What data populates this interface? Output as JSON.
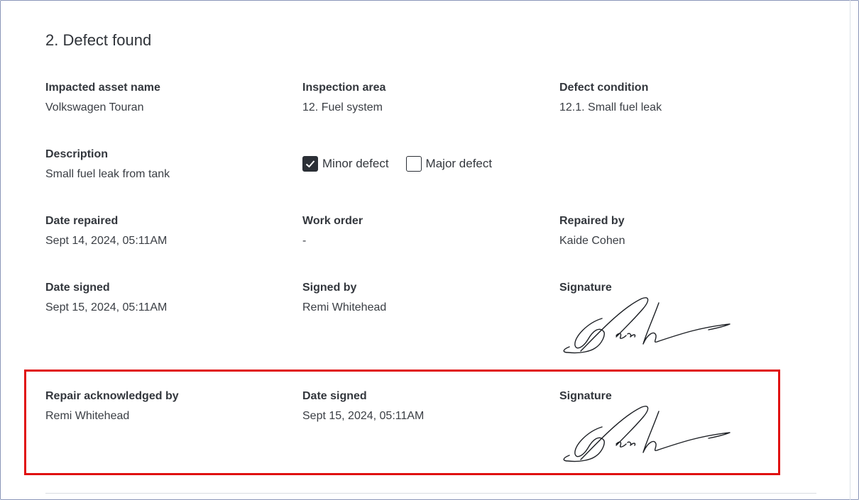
{
  "section": {
    "title": "2. Defect found"
  },
  "fields": {
    "impacted_asset": {
      "label": "Impacted asset name",
      "value": "Volkswagen Touran"
    },
    "inspection_area": {
      "label": "Inspection area",
      "value": "12. Fuel system"
    },
    "defect_condition": {
      "label": "Defect condition",
      "value": "12.1. Small fuel leak"
    },
    "description": {
      "label": "Description",
      "value": "Small fuel leak from tank"
    },
    "date_repaired": {
      "label": "Date repaired",
      "value": "Sept 14, 2024, 05:11AM"
    },
    "work_order": {
      "label": "Work order",
      "value": "-"
    },
    "repaired_by": {
      "label": "Repaired by",
      "value": "Kaide Cohen"
    },
    "date_signed": {
      "label": "Date signed",
      "value": "Sept 15, 2024, 05:11AM"
    },
    "signed_by": {
      "label": "Signed by",
      "value": "Remi Whitehead"
    },
    "signature": {
      "label": "Signature"
    }
  },
  "severity": {
    "minor": {
      "label": "Minor defect",
      "checked": true
    },
    "major": {
      "label": "Major defect",
      "checked": false
    }
  },
  "acknowledgement": {
    "acknowledged_by": {
      "label": "Repair acknowledged by",
      "value": "Remi Whitehead"
    },
    "date_signed": {
      "label": "Date signed",
      "value": "Sept 15, 2024, 05:11AM"
    },
    "signature": {
      "label": "Signature"
    }
  },
  "colors": {
    "highlight": "#e01010",
    "text": "#2b2f36",
    "checkbox_fill": "#2b2f36"
  },
  "icons": {
    "checked": "checkmark-icon"
  }
}
